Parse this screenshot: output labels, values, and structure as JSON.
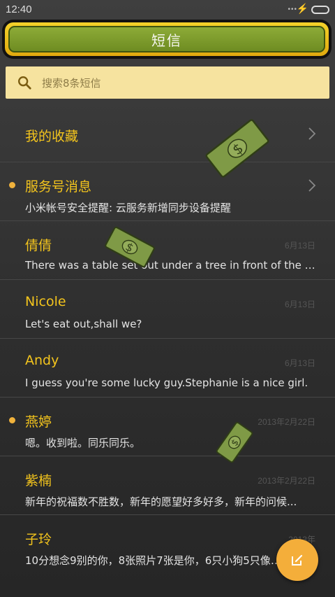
{
  "status_bar": {
    "time": "12:40",
    "signal_dots": "•••",
    "charging_icon": "⚡",
    "battery_color": "#4fd16b"
  },
  "header": {
    "title": "短信"
  },
  "search": {
    "placeholder": "搜索8条短信",
    "icon": "search-icon"
  },
  "favorites": {
    "label": "我的收藏"
  },
  "conversations": [
    {
      "name": "服务号消息",
      "preview": "小米帐号安全提醒: 云服务新增同步设备提醒",
      "date": "",
      "unread": true
    },
    {
      "name": "倩倩",
      "preview": "There was a table set out under a tree in front of the ho...",
      "date": "6月13日",
      "unread": false
    },
    {
      "name": "Nicole",
      "preview": "Let's eat out,shall we?",
      "date": "6月13日",
      "unread": false
    },
    {
      "name": "Andy",
      "preview": "I guess you're some lucky guy.Stephanie is a nice girl.",
      "date": "6月13日",
      "unread": false
    },
    {
      "name": "燕婷",
      "preview": "嗯。收到啦。同乐同乐。",
      "date": "2013年2月22日",
      "unread": true
    },
    {
      "name": "紫楠",
      "preview": "新年的祝福数不胜数，新年的愿望好多好多，新年的问候...",
      "date": "2013年2月22日",
      "unread": false
    },
    {
      "name": "子玲",
      "preview": "10分想念9别的你，8张照片7张是你，6只小狗5只像你...",
      "date": "2013年",
      "unread": false
    }
  ],
  "compose_button": {
    "icon": "edit-icon"
  },
  "colors": {
    "accent_yellow": "#f3c41d",
    "header_green": "#7d9b2c",
    "unread_dot": "#f0b23c",
    "fab_orange": "#f4ae3a"
  }
}
